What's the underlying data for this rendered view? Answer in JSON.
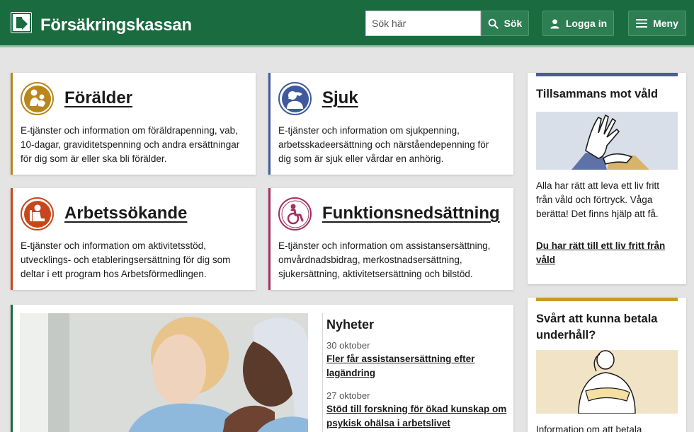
{
  "header": {
    "logo_text": "Försäkringskassan",
    "search_placeholder": "Sök här",
    "search_button": "Sök",
    "login_button": "Logga in",
    "menu_button": "Meny",
    "bg_color": "#1a6b40"
  },
  "cards": [
    {
      "title": "Förälder",
      "description": "E-tjänster och information om föräldrapenning, vab, 10-dagar, graviditetspenning och andra ersättningar för dig som är eller ska bli förälder.",
      "icon": "parent-icon",
      "color": "#b8861b"
    },
    {
      "title": "Sjuk",
      "description": "E-tjänster och information om sjukpenning, arbetsskadeersättning och närståendepenning för dig som är sjuk eller vårdar en anhörig.",
      "icon": "sick-icon",
      "color": "#3e5a9c"
    },
    {
      "title": "Arbetssökande",
      "description": "E-tjänster och information om aktivitetsstöd, utvecklings- och etableringsersättning för dig som deltar i ett program hos Arbetsförmedlingen.",
      "icon": "jobseeker-icon",
      "color": "#c8471a"
    },
    {
      "title": "Funktionsnedsättning",
      "description": "E-tjänster och information om assistansersättning, omvårdnadsbidrag, merkostnadsersättning, sjukersättning, aktivitetsersättning och bilstöd.",
      "icon": "wheelchair-icon",
      "color": "#a3305e"
    }
  ],
  "side_violence": {
    "title": "Tillsammans mot våld",
    "text": "Alla har rätt att leva ett liv fritt från våld och förtryck. Våga berätta! Det finns hjälp att få.",
    "link": "Du har rätt till ett liv fritt från våld",
    "accent": "#4a5e96"
  },
  "side_maintenance": {
    "title": "Svårt att kunna betala underhåll?",
    "text": "Information om att betala",
    "accent": "#c89a2a"
  },
  "news": {
    "title": "Nyheter",
    "items": [
      {
        "date": "30 oktober",
        "headline": "Fler får assistansersättning efter lagändring"
      },
      {
        "date": "27 oktober",
        "headline": "Stöd till forskning för ökad kunskap om psykisk ohälsa i arbetslivet"
      }
    ]
  }
}
